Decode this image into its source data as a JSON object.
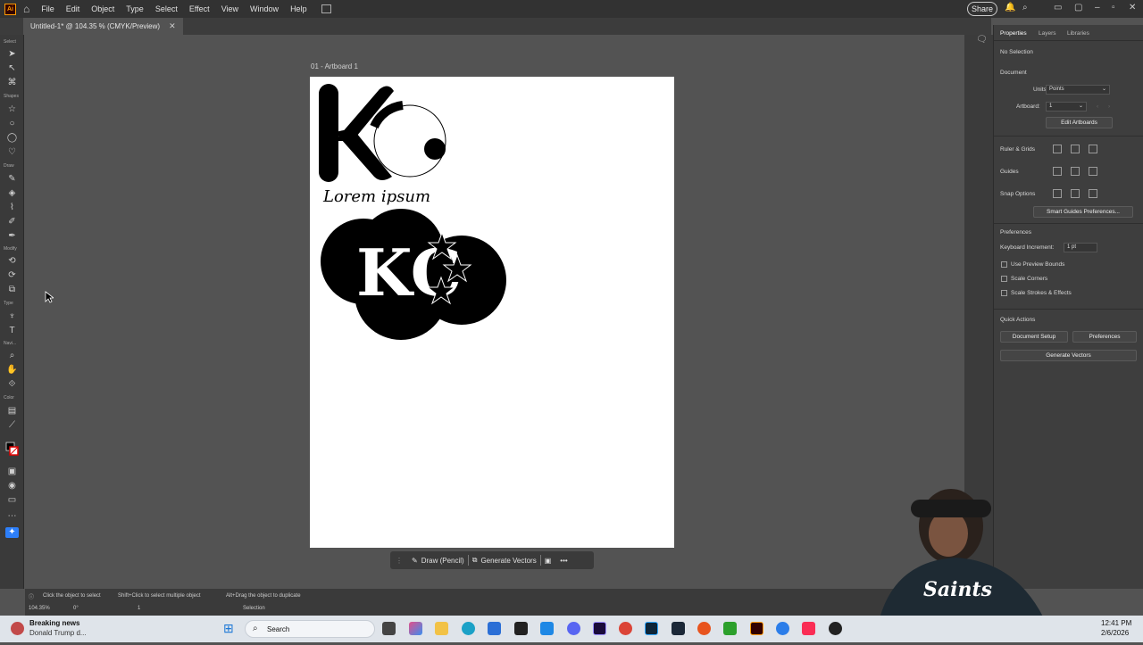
{
  "app": {
    "logo": "Ai",
    "menus": [
      "File",
      "Edit",
      "Object",
      "Type",
      "Select",
      "Effect",
      "View",
      "Window",
      "Help"
    ],
    "share_label": "Share"
  },
  "document": {
    "tab_title": "Untitled-1* @ 104.35 % (CMYK/Preview)",
    "artboard_label": "01 - Artboard 1",
    "logo_text": "Lorem ipsum"
  },
  "toolbar": {
    "sections": [
      "Select",
      "Shapes",
      "Draw",
      "Modify",
      "Type",
      "Navi...",
      "Color"
    ]
  },
  "context_bar": {
    "draw_label": "Draw (Pencil)",
    "generate_label": "Generate Vectors"
  },
  "panel": {
    "tabs": [
      "Properties",
      "Layers",
      "Libraries"
    ],
    "no_selection": "No Selection",
    "document_heading": "Document",
    "units_label": "Units:",
    "units_value": "Points",
    "artboard_label": "Artboard:",
    "artboard_value": "1",
    "edit_artboards": "Edit Artboards",
    "ruler_grids": "Ruler & Grids",
    "guides": "Guides",
    "snap_options": "Snap Options",
    "smart_guides_btn": "Smart Guides Preferences...",
    "preferences_heading": "Preferences",
    "keyboard_increment_label": "Keyboard Increment:",
    "keyboard_increment_value": "1 pt",
    "use_preview_bounds": "Use Preview Bounds",
    "scale_corners": "Scale Corners",
    "scale_strokes": "Scale Strokes & Effects",
    "quick_actions": "Quick Actions",
    "document_setup": "Document Setup",
    "preferences_btn": "Preferences",
    "generate_vectors_btn": "Generate Vectors"
  },
  "status": {
    "hint1": "Click the object to select",
    "hint2": "Shift+Click to select multiple object",
    "hint3": "Alt+Drag the object to duplicate",
    "zoom": "104.35%",
    "rotation": "0°",
    "artboard_num": "1",
    "tool_name": "Selection"
  },
  "taskbar": {
    "news_title": "Breaking news",
    "news_sub": "Donald Trump d...",
    "search_placeholder": "Search",
    "time": "12:41 PM",
    "date": "2/6/2026"
  }
}
